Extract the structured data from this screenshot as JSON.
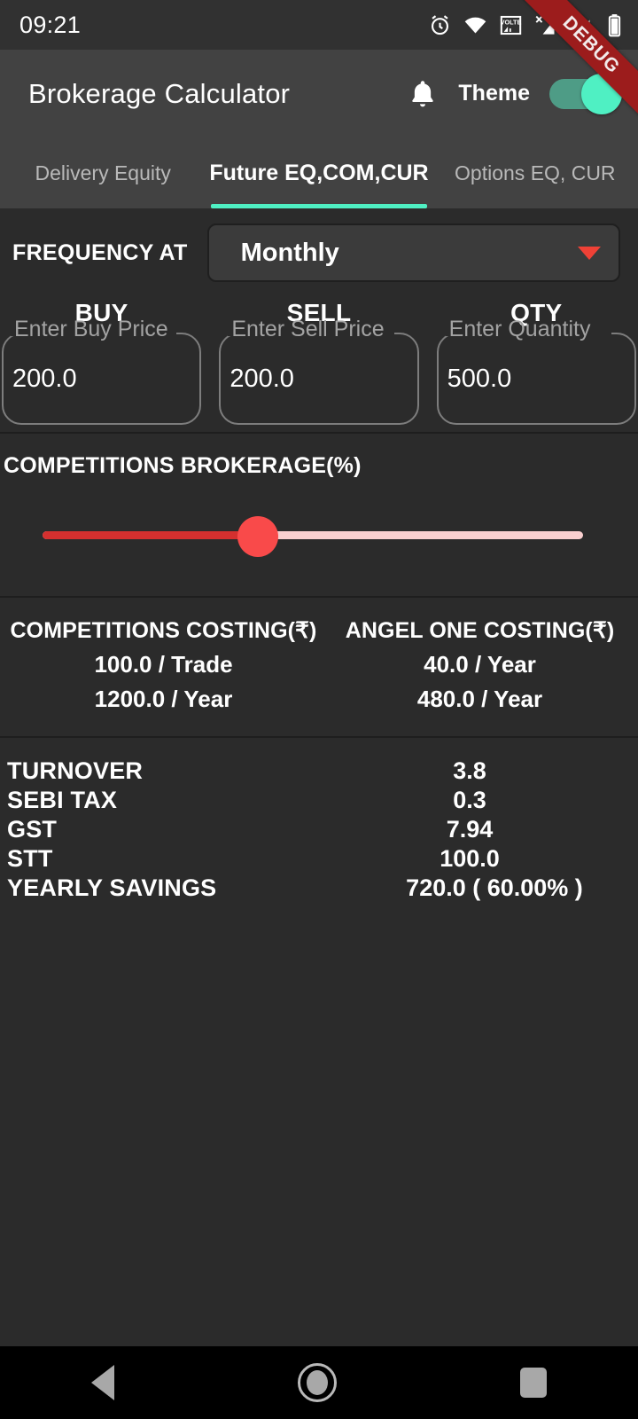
{
  "status_bar": {
    "time": "09:21",
    "icons": [
      "alarm-icon",
      "wifi-icon",
      "volte-icon",
      "signal-no-sim-icon",
      "signal-icon",
      "battery-icon"
    ]
  },
  "debug_ribbon": {
    "label": "DEBUG",
    "color": "#9c1c1c"
  },
  "app_bar": {
    "title": "Brokerage Calculator",
    "notification_icon": "bell-icon",
    "theme_label": "Theme",
    "theme_toggle_on": true,
    "accent_color": "#4ff0c3"
  },
  "tabs": {
    "active_index": 1,
    "items": [
      {
        "label": "Delivery Equity"
      },
      {
        "label": "Future EQ,COM,CUR"
      },
      {
        "label": "Options EQ, CUR"
      }
    ]
  },
  "frequency": {
    "label": "FREQUENCY AT",
    "selected": "Monthly",
    "caret_icon": "chevron-down-icon",
    "caret_color": "#ef4136"
  },
  "inputs": [
    {
      "title": "BUY",
      "placeholder": "Enter Buy Price",
      "value": "200.0"
    },
    {
      "title": "SELL",
      "placeholder": "Enter Sell Price",
      "value": "200.0"
    },
    {
      "title": "QTY",
      "placeholder": "Enter Quantity",
      "value": "500.0"
    }
  ],
  "slider": {
    "title": "COMPETITIONS BROKERAGE(%)",
    "fill_color": "#d4302f",
    "thumb_color": "#f94a4a",
    "track_color": "#f9cfcf"
  },
  "costing": {
    "competitions": {
      "heading": "COMPETITIONS COSTING(₹)",
      "per_trade": "100.0 / Trade",
      "per_year": "1200.0 / Year"
    },
    "angel_one": {
      "heading": "ANGEL ONE COSTING(₹)",
      "per_trade": "40.0 / Year",
      "per_year": "480.0 / Year"
    }
  },
  "summary": [
    {
      "label": "TURNOVER",
      "value": "3.8"
    },
    {
      "label": "SEBI TAX",
      "value": "0.3"
    },
    {
      "label": "GST",
      "value": "7.94"
    },
    {
      "label": "STT",
      "value": "100.0"
    },
    {
      "label": "YEARLY SAVINGS",
      "value": "720.0  ( 60.00% )"
    }
  ],
  "nav_bar": {
    "back": "back-icon",
    "home": "home-icon",
    "recents": "recents-icon"
  }
}
